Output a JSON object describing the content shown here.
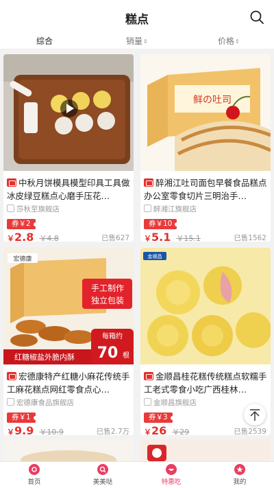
{
  "header": {
    "title": "糕点"
  },
  "sort": {
    "comprehensive": "综合",
    "sales": "销量",
    "price": "价格"
  },
  "products": [
    {
      "badge": "",
      "name": "中秋月饼模具模型印具工具做冰皮绿豆糕点心磨手压花…",
      "store": "莎秋至旗舰店",
      "coupon": "券￥2",
      "price_symbol": "￥",
      "price": "2.8",
      "original_price": "￥4.8",
      "sold": "已售627"
    },
    {
      "badge": "",
      "name": "醉湘江吐司面包早餐食品糕点办公室零食切片三明治手…",
      "store": "醉湘江旗舰店",
      "coupon": "券￥10",
      "price_symbol": "￥",
      "price": "5.1",
      "original_price": "￥15.1",
      "sold": "已售1562",
      "image_text": "鲜の吐司"
    },
    {
      "badge": "",
      "name": "宏德康特产红糖小麻花传统手工麻花糕点网红零食点心…",
      "store": "宏德康食品旗舰店",
      "coupon": "券￥1",
      "price_symbol": "￥",
      "price": "9.9",
      "original_price": "￥10.9",
      "sold": "已售2.7万",
      "image_texts": [
        "手工制作",
        "独立包装",
        "红糖椒盐外脆内酥",
        "每箱约",
        "70",
        "根",
        "宏德康"
      ]
    },
    {
      "badge": "",
      "name": "金顺昌桂花糕传统糕点软糯手工老式零食小吃广西桂林…",
      "store": "金顺昌旗舰店",
      "coupon": "券￥3",
      "price_symbol": "￥",
      "price": "26",
      "original_price": "￥29",
      "sold": "已售2539",
      "image_text": "金顺昌"
    }
  ],
  "tabs": [
    {
      "label": "首页"
    },
    {
      "label": "美美哒"
    },
    {
      "label": "特惠吃"
    },
    {
      "label": "我的"
    }
  ],
  "colors": {
    "accent": "#e4302b",
    "tab_active": "#ea3d62"
  }
}
